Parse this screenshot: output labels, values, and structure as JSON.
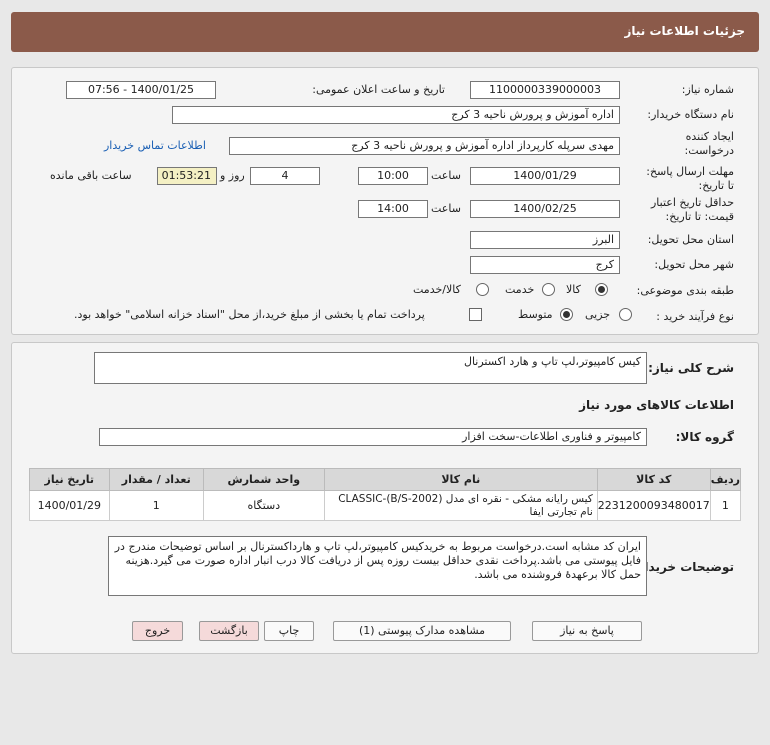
{
  "title": "جزئیات اطلاعات نیاز",
  "watermark": "ParsNamadData",
  "details": {
    "need_number_label": "شماره نیاز:",
    "need_number": "1100000339000003",
    "announce_label": "تاریخ و ساعت اعلان عمومی:",
    "announce_value": "1400/01/25 - 07:56",
    "buyer_org_label": "نام دستگاه خریدار:",
    "buyer_org": "اداره آموزش و پرورش ناحیه 3 کرج",
    "creator_label_1": "ایجاد کننده",
    "creator_label_2": "درخواست:",
    "creator": "مهدی سرپله کارپرداز اداره آموزش و پرورش ناحیه 3 کرج",
    "contact_link": "اطلاعات تماس خریدار",
    "deadline_label_1": "مهلت ارسال پاسخ:",
    "deadline_label_2": "تا تاریخ:",
    "deadline_date": "1400/01/29",
    "time_label": "ساعت",
    "deadline_time": "10:00",
    "days_value": "4",
    "days_label": "روز و",
    "remaining_time": "01:53:21",
    "remaining_label": "ساعت باقی مانده",
    "validity_label_1": "حداقل تاریخ اعتبار",
    "validity_label_2": "قیمت: تا تاریخ:",
    "validity_date": "1400/02/25",
    "validity_time_label": "ساعت",
    "validity_time": "14:00",
    "province_label": "استان محل تحویل:",
    "province": "البرز",
    "city_label": "شهر محل تحویل:",
    "city": "کرج",
    "category_label": "طبقه بندی موضوعی:",
    "category_options": [
      "کالا",
      "خدمت",
      "کالا/خدمت"
    ],
    "purchase_type_label": "نوع فرآیند خرید :",
    "purchase_options": [
      "جزیی",
      "متوسط"
    ],
    "payment_note": "پرداخت تمام یا بخشی از مبلغ خرید،از محل \"اسناد خزانه اسلامی\" خواهد بود."
  },
  "summary": {
    "general_desc_label": "شرح کلی نیاز:",
    "general_desc": "کیس کامپیوتر،لپ تاپ و هارد اکسترنال",
    "goods_info_title": "اطلاعات کالاهای مورد نیاز",
    "goods_group_label": "گروه کالا:",
    "goods_group": "کامپیوتر و فناوری اطلاعات-سخت افزار"
  },
  "table": {
    "headers": [
      "ردیف",
      "کد کالا",
      "نام کالا",
      "واحد شمارش",
      "تعداد / مقدار",
      "تاریخ نیاز"
    ],
    "rows": [
      {
        "row": "1",
        "code": "2231200093480017",
        "name": "کیس رایانه مشکی - نقره ای مدل CLASSIC-(B/S-2002) نام تجارتی ایفا",
        "unit": "دستگاه",
        "qty": "1",
        "date": "1400/01/29"
      }
    ]
  },
  "buyer_notes": {
    "label": "توضیحات خریدار:",
    "text": "ایران کد مشابه است.درخواست مربوط به خریدکیس کامپیوتر،لپ تاپ و هارداکسترنال بر اساس توضیحات مندرج در فایل پیوستی می باشد.پرداخت نقدی حداقل بیست روزه پس از دریافت کالا درب انبار اداره صورت می گیرد.هزینه حمل کالا برعهدهٔ فروشنده می باشد."
  },
  "buttons": {
    "reply": "پاسخ به نیاز",
    "attachments": "مشاهده مدارک پیوستی (1)",
    "print": "چاپ",
    "back": "بازگشت",
    "exit": "خروج"
  }
}
